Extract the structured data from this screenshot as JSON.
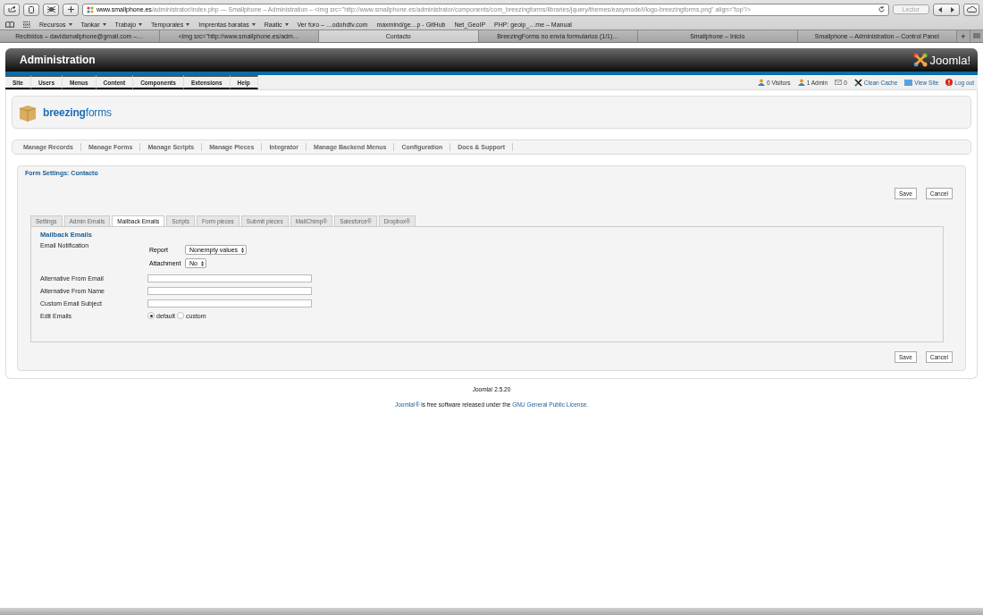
{
  "browser": {
    "url_host": "www.smallphone.es",
    "url_rest": "/administrator/index.php — Smallphone – Administration – <img src=\"http://www.smallphone.es/administrator/components/com_breezingforms/libraries/jquery/themes/easymode/i/logo-breezingforms.png\" align=\"top\"/>",
    "reader_button": "Lector",
    "bookmarks": [
      {
        "label": "Recursos",
        "has_menu": true
      },
      {
        "label": "Tankar",
        "has_menu": true
      },
      {
        "label": "Trabajo",
        "has_menu": true
      },
      {
        "label": "Temporales",
        "has_menu": true
      },
      {
        "label": "Imprentas baratas",
        "has_menu": true
      },
      {
        "label": "Raatic",
        "has_menu": true
      },
      {
        "label": "Ver foro – …odohdtv.com",
        "has_menu": false
      },
      {
        "label": "maxmind/ge…p - GitHub",
        "has_menu": false
      },
      {
        "label": "Net_GeoIP",
        "has_menu": false
      },
      {
        "label": "PHP: geoip_…me – Manual",
        "has_menu": false
      }
    ],
    "tabs": [
      {
        "label": "Recibidos – davidsmallphone@gmail.com –…",
        "selected": false
      },
      {
        "label": "<img src=\"http://www.smallphone.es/adm…",
        "selected": false
      },
      {
        "label": "Contacto",
        "selected": true
      },
      {
        "label": "BreezingForms no envía formularios (1/1)…",
        "selected": false
      },
      {
        "label": "Smallphone – Inicio",
        "selected": false
      },
      {
        "label": "Smallphone – Administration – Control Panel",
        "selected": false
      }
    ],
    "new_tab": "+"
  },
  "admin": {
    "title": "Administration",
    "brand": "Joomla!",
    "menu": [
      "Site",
      "Users",
      "Menus",
      "Content",
      "Components",
      "Extensions",
      "Help"
    ],
    "status": [
      {
        "kind": "visitors",
        "label": "0 Visitors"
      },
      {
        "kind": "admins",
        "label": "1 Admin"
      },
      {
        "kind": "messages",
        "label": "0"
      },
      {
        "kind": "cache",
        "label": "Clean Cache"
      },
      {
        "kind": "site",
        "label": "View Site"
      },
      {
        "kind": "logout",
        "label": "Log out"
      }
    ]
  },
  "component": {
    "logo": "**breezing**forms",
    "submenu": [
      "Manage Records",
      "Manage Forms",
      "Manage Scripts",
      "Manage Pieces",
      "Integrator",
      "Manage Backend Menus",
      "Configuration",
      "Docs & Support"
    ]
  },
  "form": {
    "legend": "Form Settings: Contacto",
    "buttons": [
      "Save",
      "Cancel"
    ],
    "tabs": [
      {
        "label": "Settings",
        "selected": false
      },
      {
        "label": "Admin Emails",
        "selected": false
      },
      {
        "label": "Mailback Emails",
        "selected": true
      },
      {
        "label": "Scripts",
        "selected": false
      },
      {
        "label": "Form pieces",
        "selected": false
      },
      {
        "label": "Submit pieces",
        "selected": false
      },
      {
        "label": "MailChimp®",
        "selected": false
      },
      {
        "label": "Salesforce®",
        "selected": false
      },
      {
        "label": "Dropbox®",
        "selected": false
      }
    ],
    "section_title": "Mailback Emails",
    "notification": {
      "label": "Email Notification",
      "options": [
        {
          "label": "Report",
          "value": "Nonempty values"
        },
        {
          "label": "Attachment",
          "value": "No"
        }
      ]
    },
    "fields": [
      {
        "label": "Alternative From Email"
      },
      {
        "label": "Alternative From Name"
      },
      {
        "label": "Custom Email Subject"
      }
    ],
    "edit_emails": {
      "label": "Edit Emails",
      "options": [
        {
          "label": "default",
          "selected": true
        },
        {
          "label": "custom",
          "selected": false
        }
      ]
    },
    "bottom_buttons": [
      "Save",
      "Cancel"
    ]
  },
  "footer": {
    "version": "Joomla! 2.5.20",
    "license": [
      {
        "kind": "link",
        "text": "Joomla!®"
      },
      {
        "kind": "text",
        "text": " is free software released under the "
      },
      {
        "kind": "link",
        "text": "GNU General Public License."
      }
    ]
  }
}
